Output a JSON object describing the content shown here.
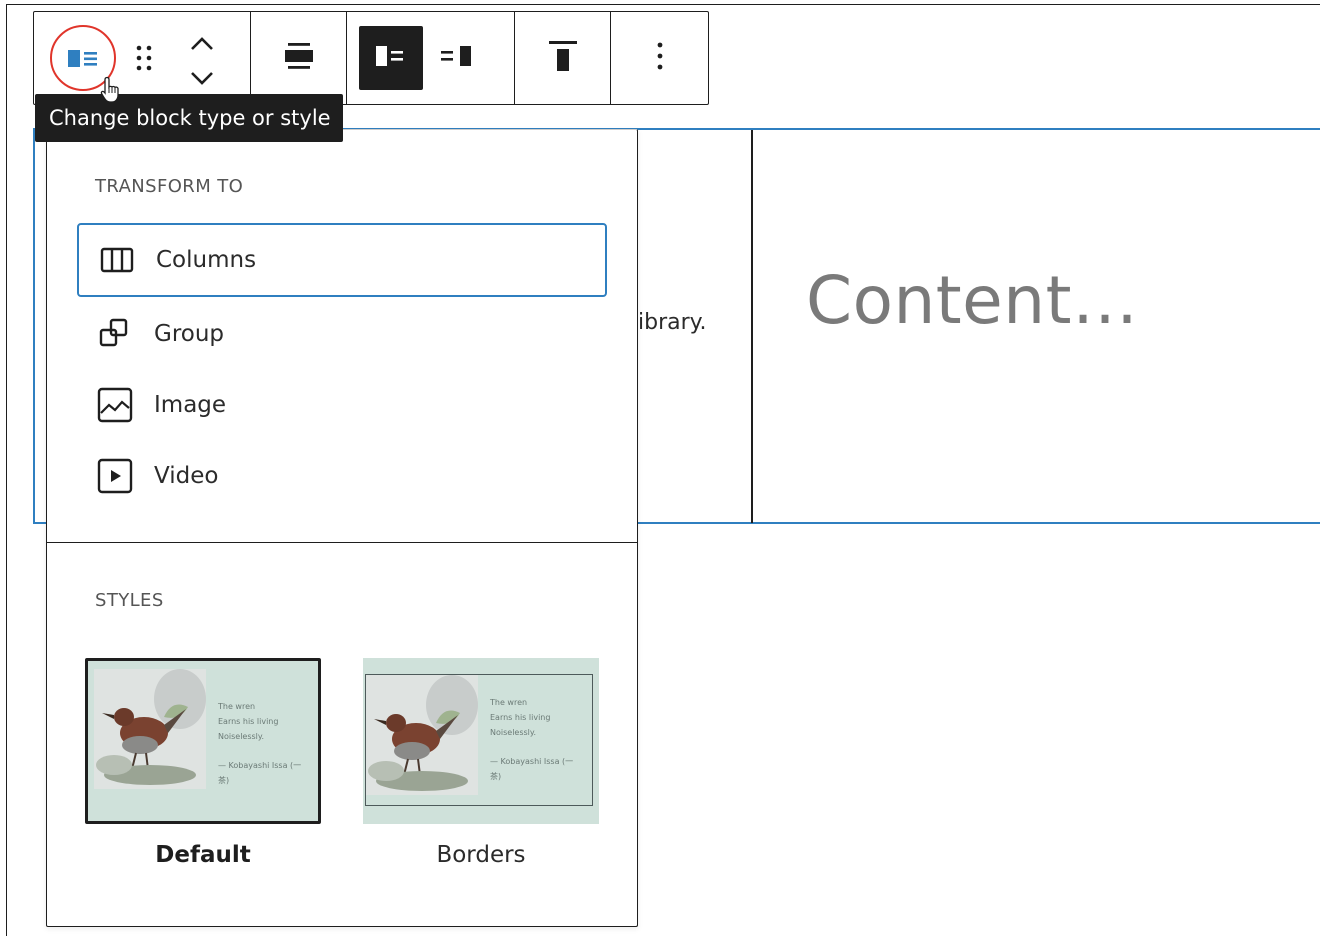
{
  "toolbar": {
    "block_type_icon": "media-text-icon",
    "drag_icon": "drag-handle-icon",
    "move_up_icon": "chevron-up-icon",
    "move_down_icon": "chevron-down-icon",
    "align_icon": "align-center-icon",
    "media_left_icon": "media-left-icon",
    "media_right_icon": "media-right-icon",
    "vertical_align_icon": "vertical-align-top-icon",
    "more_options_icon": "more-vertical-icon"
  },
  "tooltip": {
    "text": "Change block type or style"
  },
  "background_block": {
    "fragment_text": "ibrary.",
    "content_placeholder": "Content…"
  },
  "dropdown": {
    "transform_title": "TRANSFORM TO",
    "items": [
      {
        "label": "Columns",
        "icon": "columns-icon",
        "selected": true
      },
      {
        "label": "Group",
        "icon": "group-icon",
        "selected": false
      },
      {
        "label": "Image",
        "icon": "image-icon",
        "selected": false
      },
      {
        "label": "Video",
        "icon": "video-icon",
        "selected": false
      }
    ],
    "styles_title": "STYLES",
    "styles": [
      {
        "label": "Default",
        "selected": true
      },
      {
        "label": "Borders",
        "selected": false
      }
    ],
    "preview_poem": {
      "line1": "The wren",
      "line2": "Earns his living",
      "line3": "Noiselessly.",
      "line4": "— Kobayashi Issa (一",
      "line5": "茶)"
    }
  },
  "colors": {
    "accent": "#2f7fc0",
    "highlight_ring": "#e0352b",
    "tooltip_bg": "#1e1e1e",
    "preview_bg": "#cfe1da"
  }
}
